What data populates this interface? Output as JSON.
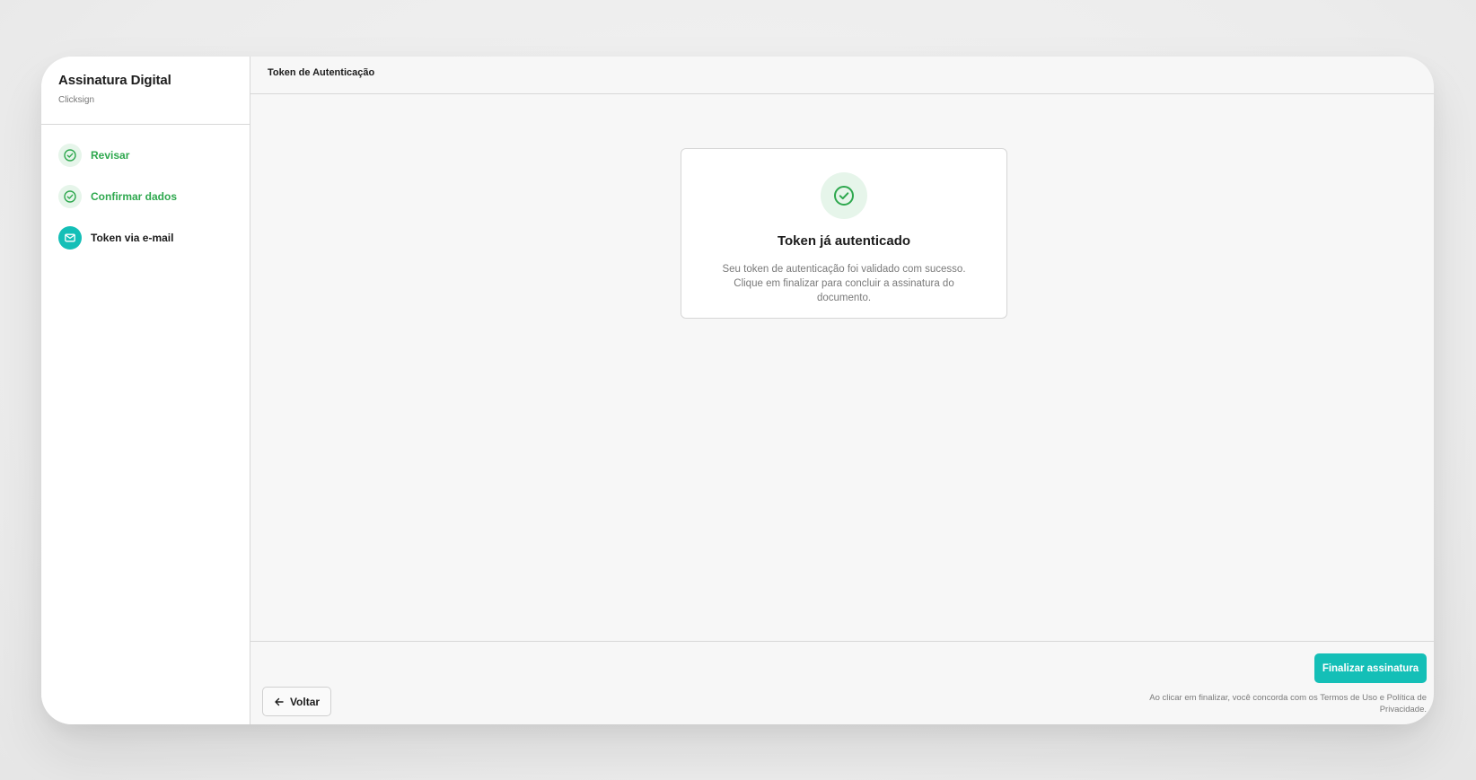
{
  "sidebar": {
    "title": "Assinatura Digital",
    "subtitle": "Clicksign",
    "steps": [
      {
        "label": "Revisar",
        "status": "done",
        "icon": "check-circle-icon"
      },
      {
        "label": "Confirmar dados",
        "status": "done",
        "icon": "check-circle-icon"
      },
      {
        "label": "Token via e-mail",
        "status": "active",
        "icon": "mail-icon"
      }
    ]
  },
  "main": {
    "title": "Token de Autenticação"
  },
  "card": {
    "icon": "check-circle-icon",
    "title": "Token já autenticado",
    "text": "Seu token de autenticação foi validado com sucesso. Clique em finalizar para concluir a assinatura do documento."
  },
  "footer": {
    "back_label": "Voltar",
    "back_icon": "arrow-left-icon",
    "finish_label": "Finalizar assinatura",
    "terms": "Ao clicar em finalizar, você concorda com os Termos de Uso e Política de Privacidade."
  },
  "colors": {
    "accent": "#14bfb7",
    "success": "#2ea84e",
    "success_bg": "#e6f5ea"
  }
}
